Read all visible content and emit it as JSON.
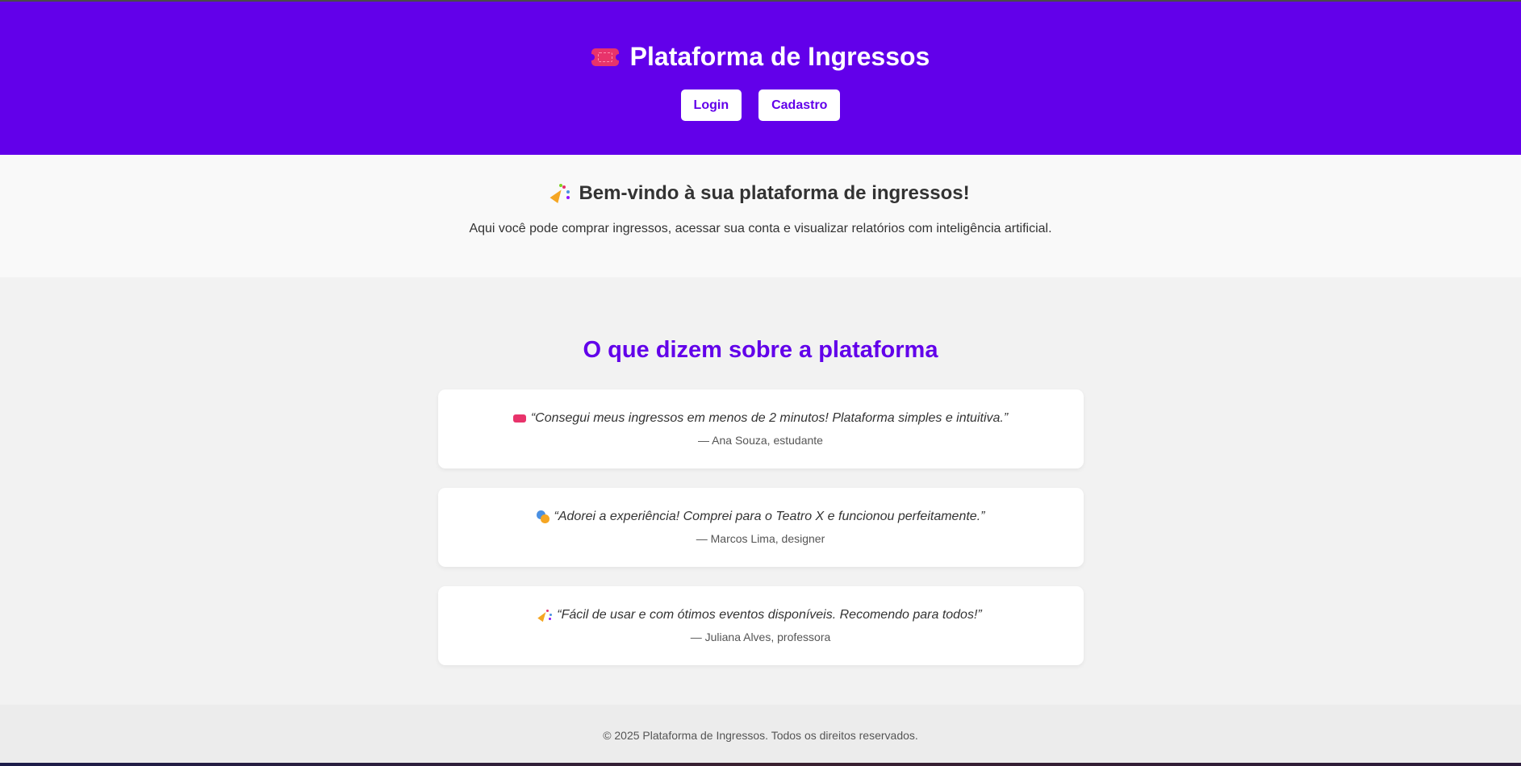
{
  "colors": {
    "brand_purple": "#6200ea",
    "header_text": "#ffffff",
    "body_text": "#333333",
    "muted_text": "#555555",
    "ticket_pink": "#e8336b"
  },
  "header": {
    "icon": "ticket-icon",
    "title": "Plataforma de Ingressos",
    "nav": {
      "login_label": "Login",
      "signup_label": "Cadastro"
    }
  },
  "welcome": {
    "icon": "party-popper-icon",
    "title": "Bem-vindo à sua plataforma de ingressos!",
    "description": "Aqui você pode comprar ingressos, acessar sua conta e visualizar relatórios com inteligência artificial."
  },
  "testimonials": {
    "title": "O que dizem sobre a plataforma",
    "items": [
      {
        "icon": "ticket-icon",
        "quote": "“Consegui meus ingressos em menos de 2 minutos! Plataforma simples e intuitiva.”",
        "author": "— Ana Souza, estudante"
      },
      {
        "icon": "theater-masks-icon",
        "quote": "“Adorei a experiência! Comprei para o Teatro X e funcionou perfeitamente.”",
        "author": "— Marcos Lima, designer"
      },
      {
        "icon": "party-popper-icon",
        "quote": "“Fácil de usar e com ótimos eventos disponíveis. Recomendo para todos!”",
        "author": "— Juliana Alves, professora"
      }
    ]
  },
  "footer": {
    "text": "© 2025 Plataforma de Ingressos. Todos os direitos reservados."
  }
}
